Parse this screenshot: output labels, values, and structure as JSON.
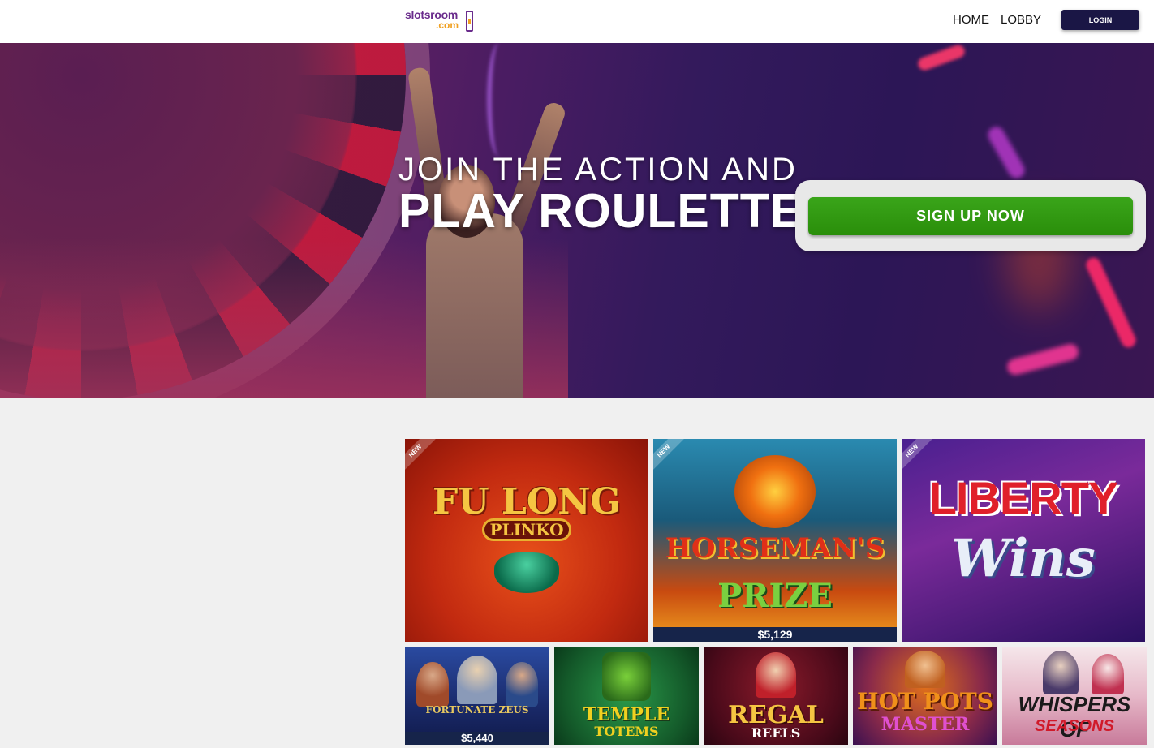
{
  "header": {
    "logo_top": "slotsroom",
    "logo_bottom": ".com",
    "nav": [
      {
        "label": "HOME"
      },
      {
        "label": "LOBBY"
      }
    ],
    "login_label": "LOGIN"
  },
  "hero": {
    "line1": "JOIN THE ACTION AND",
    "line2": "PLAY ROULETTE",
    "cta_label": "SIGN UP NOW"
  },
  "games": [
    {
      "title": "FU LONG",
      "subtitle": "PLINKO",
      "badge": "NEW",
      "jackpot": ""
    },
    {
      "title": "HORSEMAN'S",
      "subtitle": "PRIZE",
      "badge": "NEW",
      "jackpot": "$5,129"
    },
    {
      "title": "LIBERTY",
      "subtitle": "Wins",
      "badge": "NEW",
      "jackpot": ""
    },
    {
      "title": "FORTUNATE ZEUS",
      "subtitle": "",
      "badge": "",
      "jackpot": "$5,440"
    },
    {
      "title": "TEMPLE",
      "subtitle": "TOTEMS",
      "badge": "",
      "jackpot": ""
    },
    {
      "title": "REGAL",
      "subtitle": "REELS",
      "badge": "",
      "jackpot": ""
    },
    {
      "title": "HOT POTS",
      "subtitle": "MASTER",
      "badge": "",
      "jackpot": ""
    },
    {
      "title": "WHISPERS OF",
      "subtitle": "SEASONS",
      "badge": "",
      "jackpot": ""
    }
  ],
  "colors": {
    "cta": "#2e9a0e",
    "login_bg": "#1a1645",
    "jackpot_bar": "#16244a",
    "page_bg": "#f0f0f0"
  }
}
